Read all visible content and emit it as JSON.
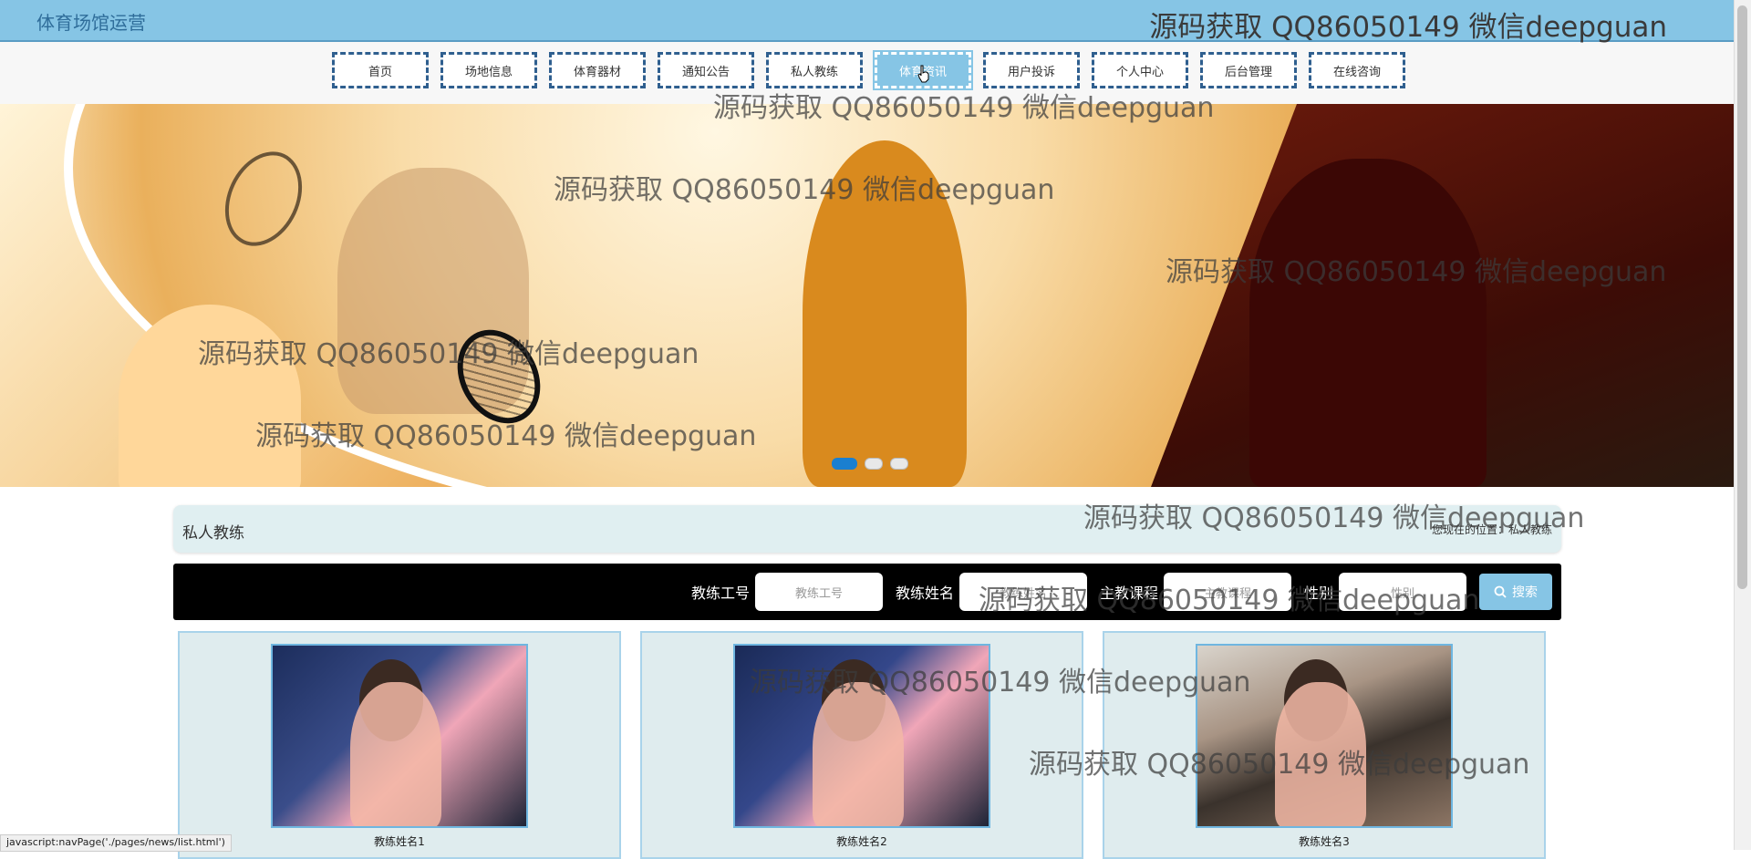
{
  "header": {
    "site_title": "体育场馆运营",
    "watermark": "源码获取 QQ86050149 微信deepguan"
  },
  "nav": {
    "items": [
      "首页",
      "场地信息",
      "体育器材",
      "通知公告",
      "私人教练",
      "体育资讯",
      "用户投诉",
      "个人中心",
      "后台管理",
      "在线咨询"
    ],
    "active_index": 5
  },
  "banner": {
    "slides_count": 3,
    "active_slide": 1
  },
  "section": {
    "title": "私人教练",
    "breadcrumb": "您现在的位置：私人教练"
  },
  "search": {
    "fields": [
      {
        "label": "教练工号",
        "placeholder": "教练工号"
      },
      {
        "label": "教练姓名",
        "placeholder": "教练姓名"
      },
      {
        "label": "主教课程",
        "placeholder": "主教课程"
      },
      {
        "label": "性别",
        "placeholder": "性别"
      }
    ],
    "button_label": "搜索"
  },
  "cards": [
    {
      "name": "教练姓名1"
    },
    {
      "name": "教练姓名2"
    },
    {
      "name": "教练姓名3"
    }
  ],
  "statusbar": {
    "text": "javascript:navPage('./pages/news/list.html')"
  },
  "colors": {
    "header_bg": "#86c5e5",
    "nav_border": "#2f5f8f",
    "section_bg": "#e0eff1",
    "searchbar_bg": "#000000",
    "button_bg": "#86c5e5"
  }
}
